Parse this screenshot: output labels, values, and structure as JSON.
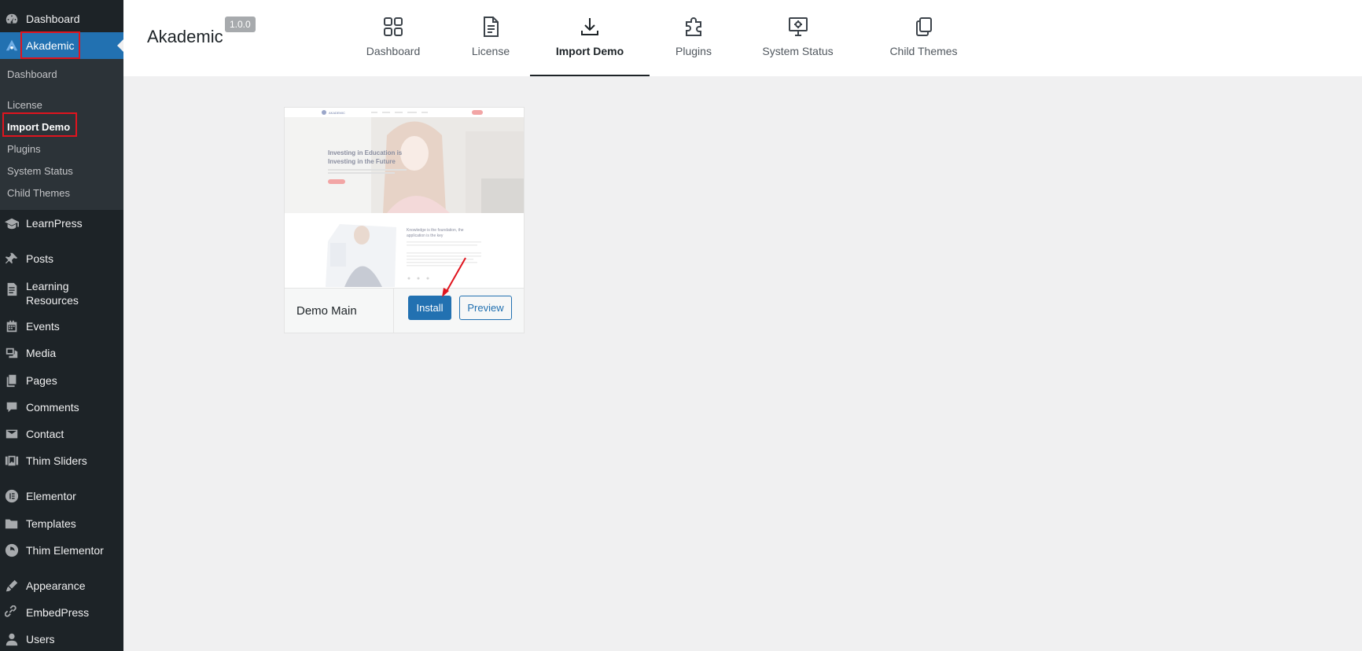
{
  "sidebar": {
    "menu": {
      "dashboard": "Dashboard",
      "akademic": "Akademic",
      "learnpress": "LearnPress",
      "posts": "Posts",
      "learning_resources_1": "Learning",
      "learning_resources_2": "Resources",
      "events": "Events",
      "media": "Media",
      "pages": "Pages",
      "comments": "Comments",
      "contact": "Contact",
      "thim_sliders": "Thim Sliders",
      "elementor": "Elementor",
      "templates": "Templates",
      "thim_elementor": "Thim Elementor",
      "appearance": "Appearance",
      "embedpress": "EmbedPress",
      "users": "Users"
    },
    "submenu": {
      "dashboard": "Dashboard",
      "license": "License",
      "import_demo": "Import Demo",
      "plugins": "Plugins",
      "system_status": "System Status",
      "child_themes": "Child Themes"
    }
  },
  "header": {
    "brand": "Akademic",
    "version": "1.0.0",
    "tabs": {
      "dashboard": "Dashboard",
      "license": "License",
      "import_demo": "Import Demo",
      "plugins": "Plugins",
      "system_status": "System Status",
      "child_themes": "Child Themes"
    }
  },
  "demo_card": {
    "name": "Demo Main",
    "install_label": "Install",
    "preview_label": "Preview",
    "thumbnail": {
      "logo_text": "AKADEMIC",
      "hero_line1": "Investing in Education is",
      "hero_line2": "Investing in the Future",
      "section_line1": "Knowledge is the foundation, the",
      "section_line2": "application is the key"
    }
  },
  "colors": {
    "sidebar_bg": "#1d2327",
    "accent": "#2271b1",
    "highlight_box": "#e0141e"
  }
}
